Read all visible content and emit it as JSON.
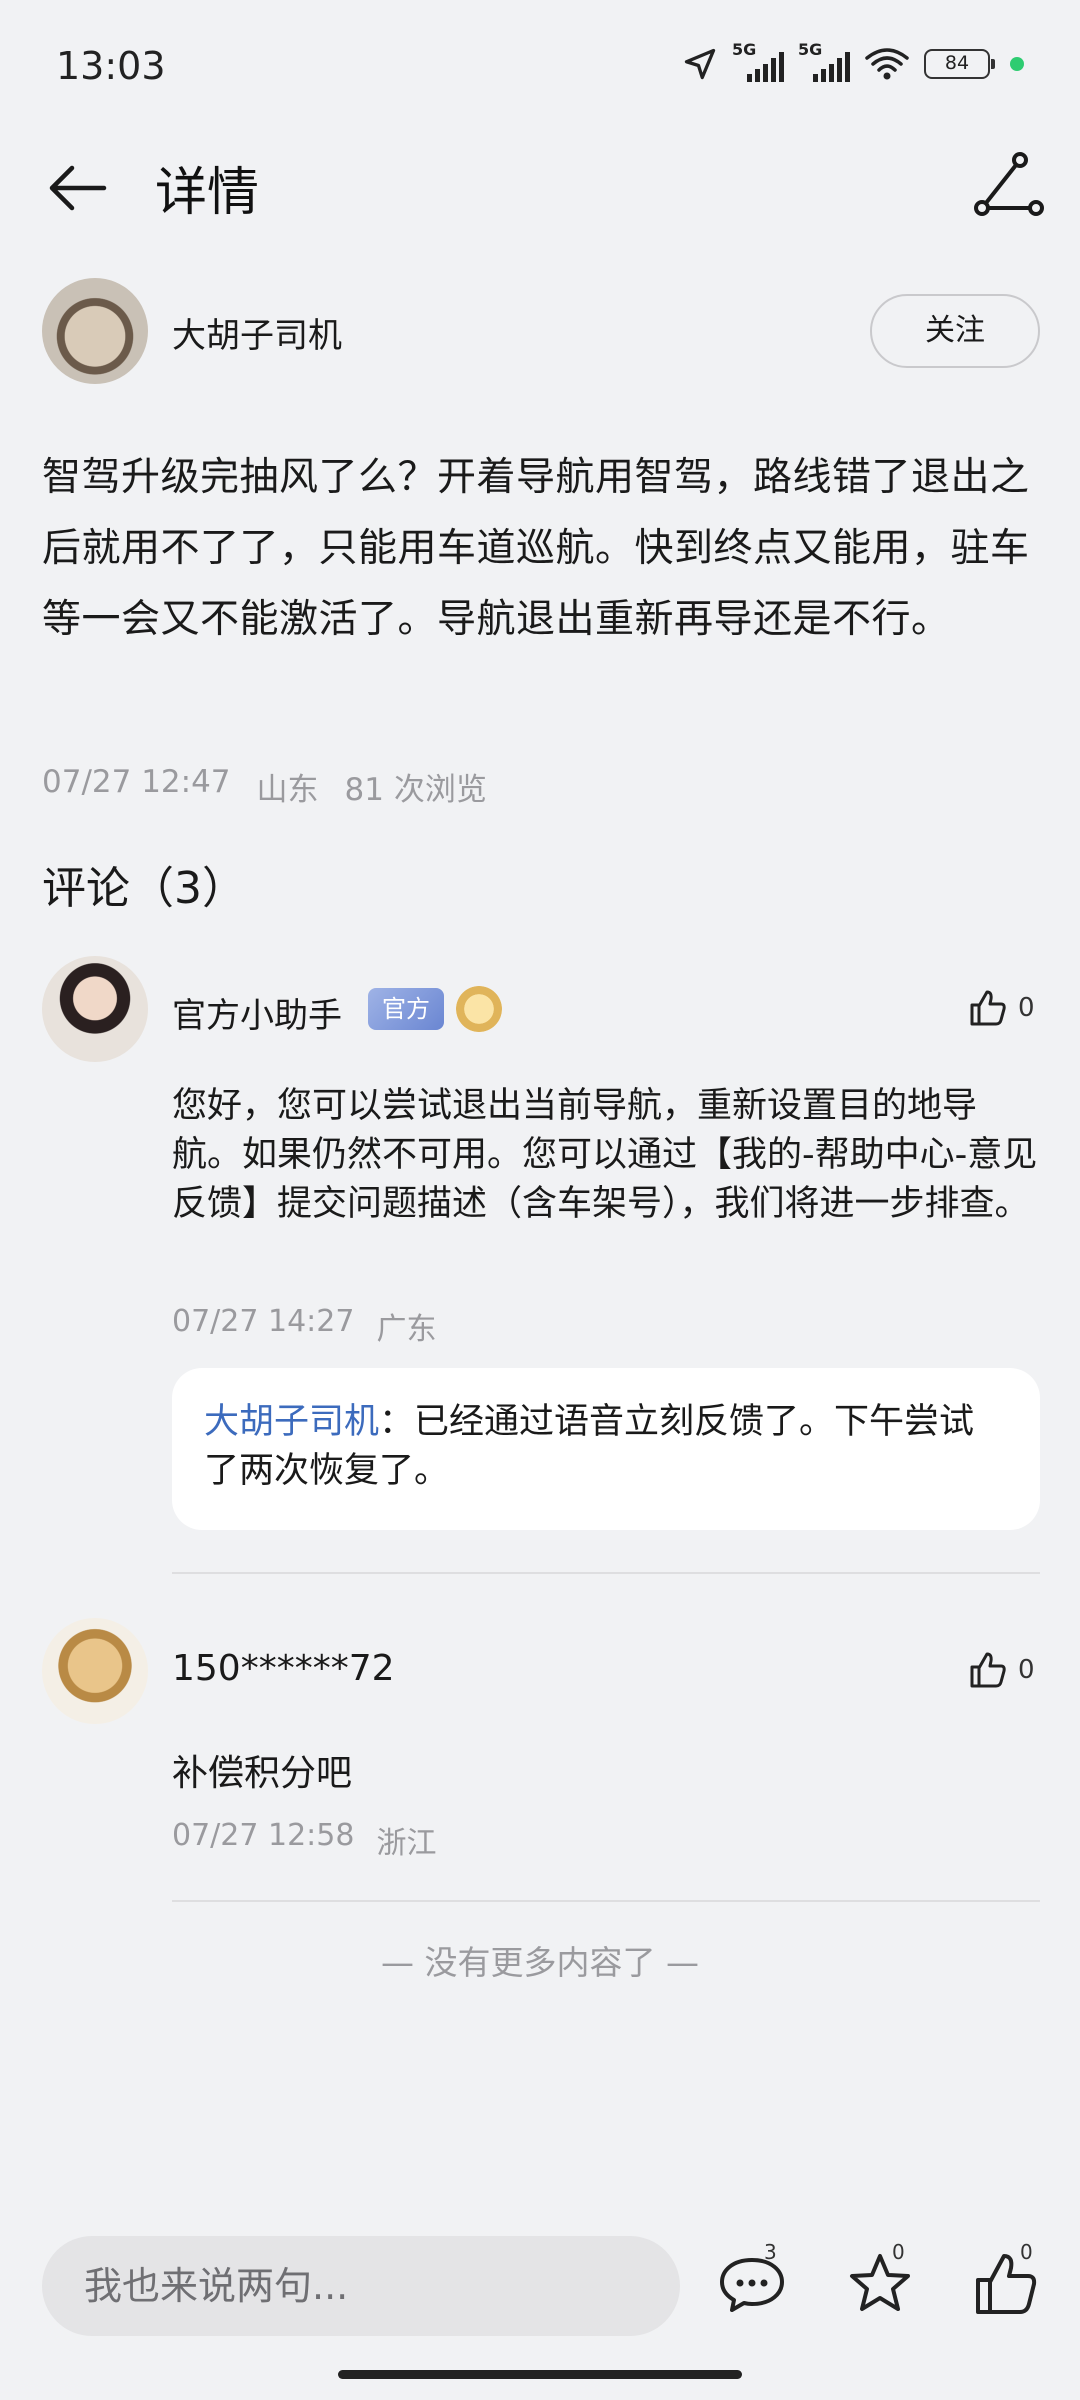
{
  "status": {
    "time": "13:03",
    "net1": "5G",
    "net2": "5G",
    "battery": "84"
  },
  "header": {
    "title": "详情"
  },
  "author": {
    "name": "大胡子司机",
    "follow_label": "关注"
  },
  "post": {
    "text": "智驾升级完抽风了么？开着导航用智驾，路线错了退出之后就用不了了，只能用车道巡航。快到终点又能用，驻车等一会又不能激活了。导航退出重新再导还是不行。",
    "date": "07/27 12:47",
    "location": "山东",
    "views": "81 次浏览"
  },
  "comments_title": "评论（3）",
  "comments": [
    {
      "name": "官方小助手",
      "badge": "官方",
      "likes": "0",
      "text": "您好，您可以尝试退出当前导航，重新设置目的地导航。如果仍然不可用。您可以通过【我的-帮助中心-意见反馈】提交问题描述（含车架号），我们将进一步排查。",
      "date": "07/27 14:27",
      "location": "广东",
      "reply": {
        "author": "大胡子司机",
        "sep": "：",
        "text": "已经通过语音立刻反馈了。下午尝试了两次恢复了。"
      }
    },
    {
      "name": "150******72",
      "likes": "0",
      "text": "补偿积分吧",
      "date": "07/27 12:58",
      "location": "浙江"
    }
  ],
  "no_more": "— 没有更多内容了 —",
  "bottom": {
    "input_placeholder": "我也来说两句...",
    "comment_count": "3",
    "favorite_count": "0",
    "like_count": "0"
  }
}
